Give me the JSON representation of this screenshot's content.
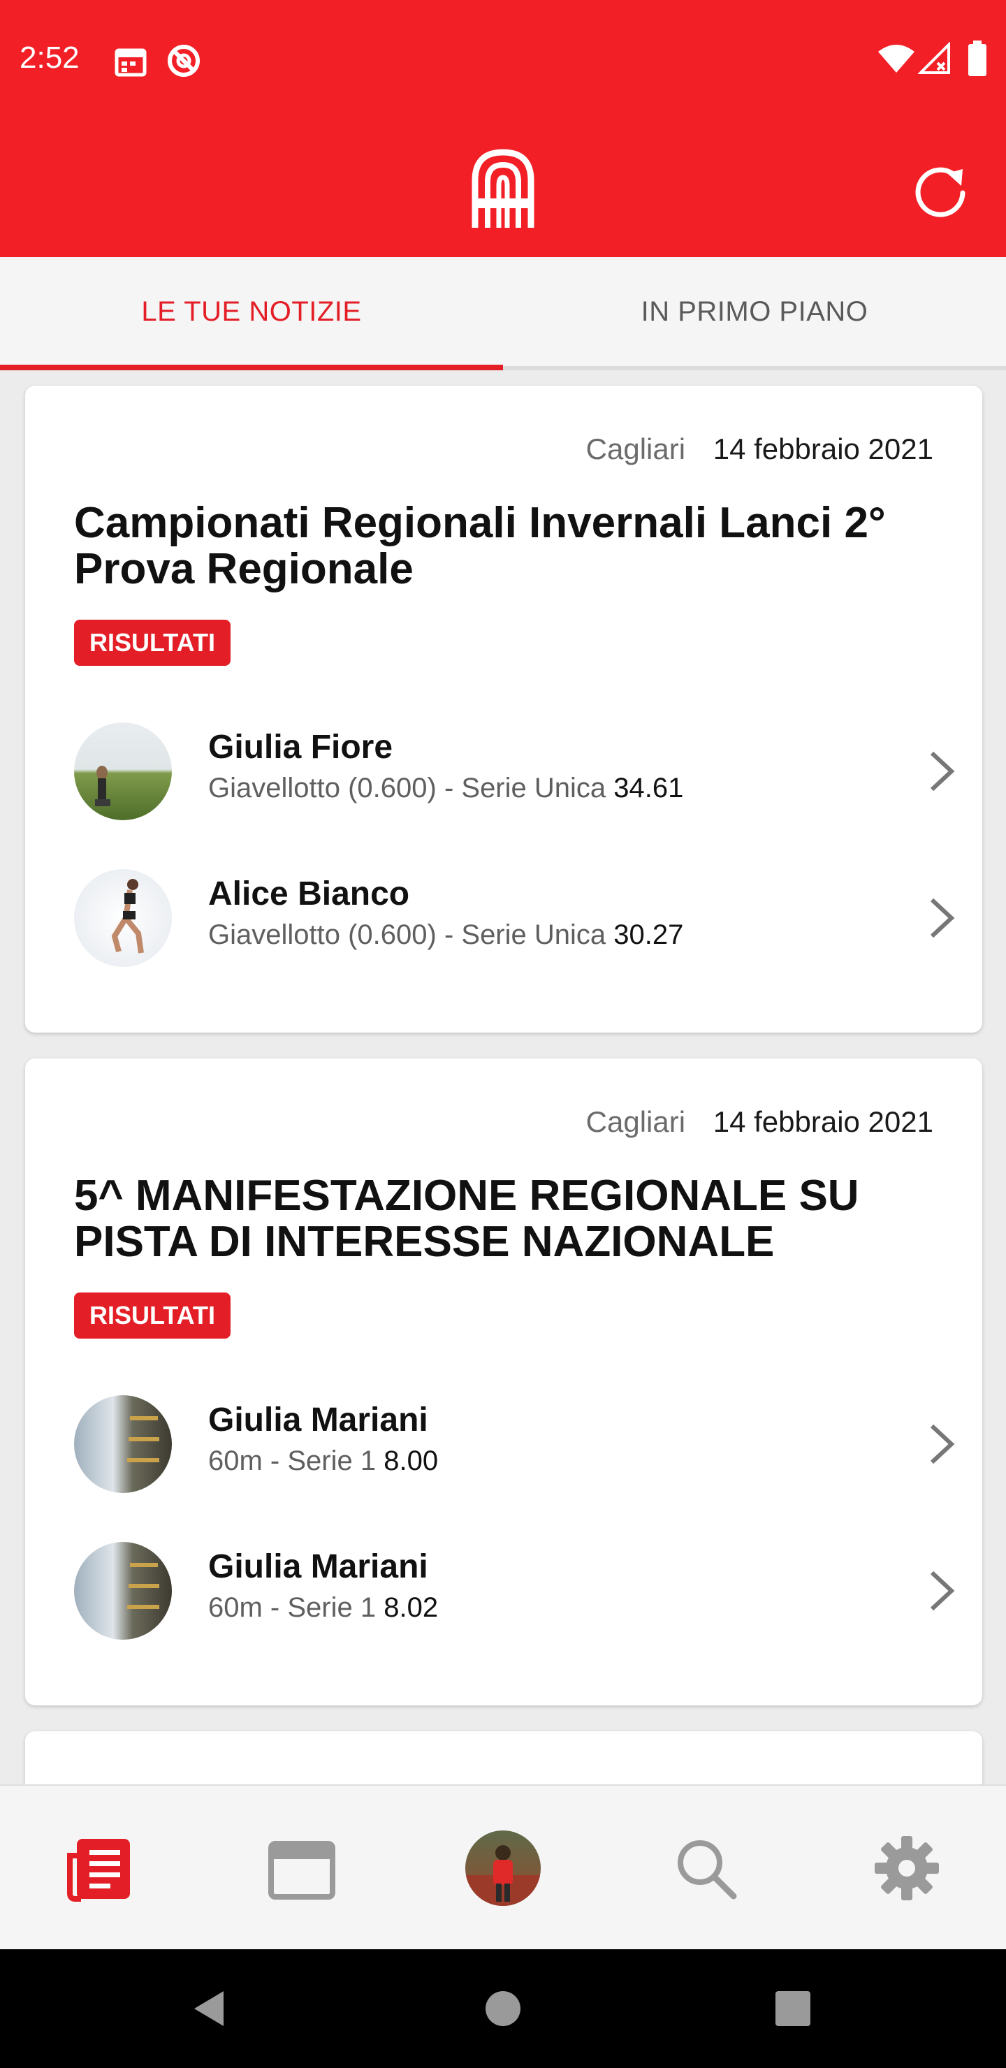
{
  "status_bar": {
    "time": "2:52",
    "icons": [
      "calendar-icon",
      "do-not-disturb-icon",
      "wifi-icon",
      "signal-icon",
      "battery-icon"
    ]
  },
  "app_bar": {
    "logo_icon": "athletics-logo-icon",
    "refresh_icon": "refresh-icon"
  },
  "tabs": [
    {
      "label": "LE TUE NOTIZIE",
      "active": true
    },
    {
      "label": "IN PRIMO PIANO",
      "active": false
    }
  ],
  "cards": [
    {
      "city": "Cagliari",
      "date": "14 febbraio 2021",
      "title": "Campionati Regionali Invernali Lanci 2° Prova Regionale",
      "badge": "RISULTATI",
      "results": [
        {
          "name": "Giulia Fiore",
          "event": "Giavellotto (0.600) - Serie Unica",
          "score": "34.61"
        },
        {
          "name": "Alice Bianco",
          "event": "Giavellotto (0.600) - Serie Unica",
          "score": "30.27"
        }
      ]
    },
    {
      "city": "Cagliari",
      "date": "14 febbraio 2021",
      "title": "5^ MANIFESTAZIONE REGIONALE SU PISTA DI INTERESSE NAZIONALE",
      "badge": "RISULTATI",
      "results": [
        {
          "name": "Giulia Mariani",
          "event": "60m - Serie 1",
          "score": "8.00"
        },
        {
          "name": "Giulia Mariani",
          "event": "60m - Serie 1",
          "score": "8.02"
        }
      ]
    }
  ],
  "bottom_nav": [
    {
      "icon": "news-icon",
      "active": true
    },
    {
      "icon": "calendar-icon",
      "active": false
    },
    {
      "icon": "profile-avatar",
      "active": false
    },
    {
      "icon": "search-icon",
      "active": false
    },
    {
      "icon": "settings-gear-icon",
      "active": false
    }
  ],
  "system_nav": [
    "back-icon",
    "home-icon",
    "recents-icon"
  ],
  "colors": {
    "accent": "#e41e26",
    "header": "#f21f26"
  }
}
